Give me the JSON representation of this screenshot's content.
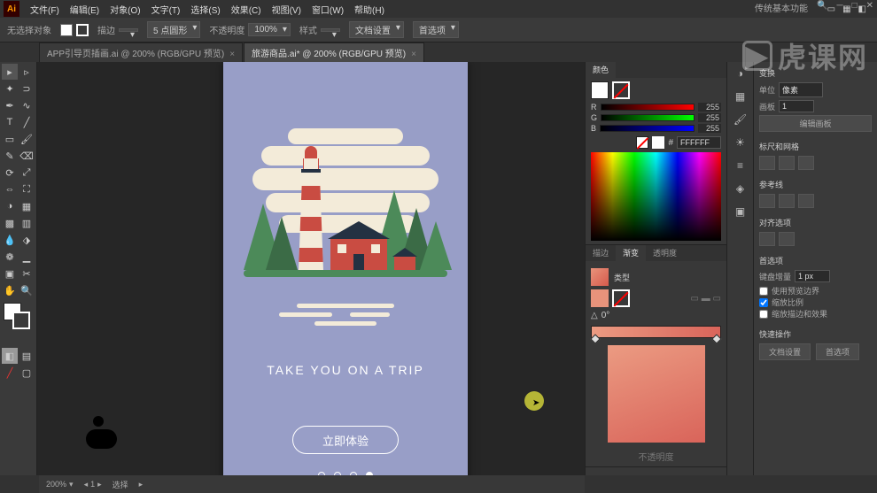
{
  "app": {
    "logo": "Ai"
  },
  "menu": [
    "文件(F)",
    "编辑(E)",
    "对象(O)",
    "文字(T)",
    "选择(S)",
    "效果(C)",
    "视图(V)",
    "窗口(W)",
    "帮助(H)"
  ],
  "workspace_label": "传统基本功能",
  "options": {
    "tool_label": "无选择对象",
    "stroke_label": "描边",
    "stroke_val": "",
    "uniform": "5 点圆形",
    "opacity_label": "不透明度",
    "opacity_val": "100%",
    "style_label": "样式",
    "docset": "文档设置",
    "prefs": "首选项"
  },
  "tabs": [
    {
      "label": "APP引导页插画.ai @ 200% (RGB/GPU 预览)",
      "active": false
    },
    {
      "label": "旅游商品.ai* @ 200% (RGB/GPU 预览)",
      "active": true
    }
  ],
  "artboard": {
    "headline": "TAKE YOU ON A TRIP",
    "cta": "立即体验"
  },
  "color_panel": {
    "tab": "颜色",
    "r": "255",
    "g": "255",
    "b": "255",
    "hex": "FFFFFF"
  },
  "gradient_panel": {
    "tabs": [
      "描边",
      "渐变",
      "透明度"
    ],
    "type_label": "类型",
    "angle": "0°",
    "footer_label": "不透明度"
  },
  "props": {
    "section1": "变换",
    "units_label": "单位",
    "units_val": "像素",
    "artboard_label": "画板",
    "artboard_val": "1",
    "edit_artboard": "编辑画板",
    "section2": "标尺和网格",
    "section3": "参考线",
    "section4": "对齐选项",
    "section5": "首选项",
    "key_inc_label": "键盘增量",
    "key_inc_val": "1 px",
    "cb1": "使用预览边界",
    "cb2": "缩放比例",
    "cb3": "缩放描边和效果",
    "section6": "快速操作",
    "btn1": "文档设置",
    "btn2": "首选项"
  },
  "status": {
    "zoom": "200%",
    "nav": "1",
    "tool": "选择"
  },
  "watermark": "虎课网"
}
